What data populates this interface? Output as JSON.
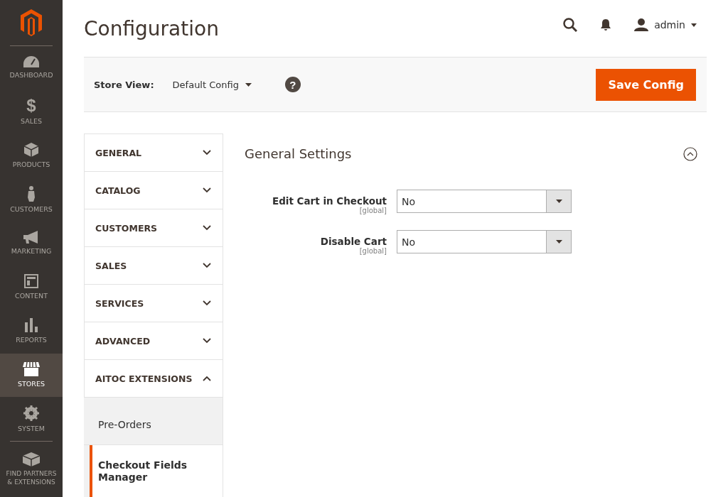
{
  "sidebar": {
    "items": [
      {
        "label": "DASHBOARD",
        "selected": false
      },
      {
        "label": "SALES",
        "selected": false,
        "glyph": "$"
      },
      {
        "label": "PRODUCTS",
        "selected": false
      },
      {
        "label": "CUSTOMERS",
        "selected": false
      },
      {
        "label": "MARKETING",
        "selected": false
      },
      {
        "label": "CONTENT",
        "selected": false
      },
      {
        "label": "REPORTS",
        "selected": false
      },
      {
        "label": "STORES",
        "selected": true
      },
      {
        "label": "SYSTEM",
        "selected": false
      },
      {
        "label": "FIND PARTNERS & EXTENSIONS",
        "selected": false
      }
    ]
  },
  "header": {
    "title": "Configuration",
    "user": "admin"
  },
  "store_bar": {
    "label": "Store View:",
    "value": "Default Config",
    "help_glyph": "?",
    "save_button": "Save Config"
  },
  "config_nav": [
    {
      "label": "GENERAL",
      "expanded": false
    },
    {
      "label": "CATALOG",
      "expanded": false
    },
    {
      "label": "CUSTOMERS",
      "expanded": false
    },
    {
      "label": "SALES",
      "expanded": false
    },
    {
      "label": "SERVICES",
      "expanded": false
    },
    {
      "label": "ADVANCED",
      "expanded": false
    },
    {
      "label": "AITOC EXTENSIONS",
      "expanded": true,
      "children": [
        {
          "label": "Pre-Orders",
          "selected": false
        },
        {
          "label": "Checkout Fields Manager",
          "selected": true
        }
      ]
    }
  ],
  "section": {
    "title": "General Settings",
    "expanded": true,
    "fields": [
      {
        "label": "Edit Cart in Checkout",
        "scope": "[global]",
        "value": "No"
      },
      {
        "label": "Disable Cart",
        "scope": "[global]",
        "value": "No"
      }
    ]
  }
}
